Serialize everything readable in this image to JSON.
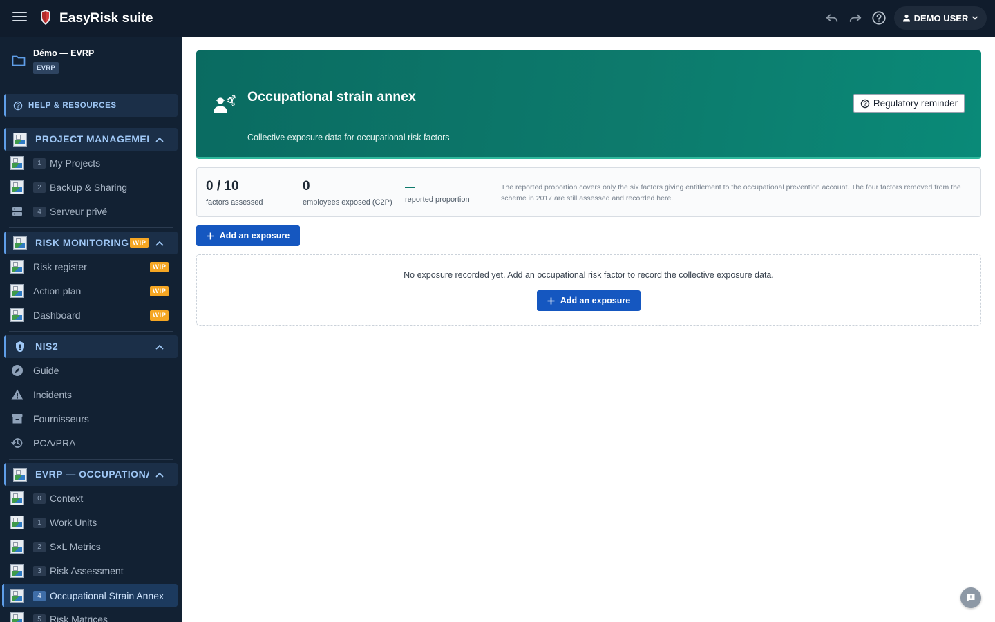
{
  "app": {
    "title": "EasyRisk suite",
    "user_label": "DEMO USER"
  },
  "project": {
    "name": "Démo — EVRP",
    "badge": "EVRP"
  },
  "sidebar": {
    "help_label": "HELP & RESOURCES",
    "project_management": {
      "label": "PROJECT MANAGEMEN",
      "items": [
        {
          "num": "1",
          "label": "My Projects"
        },
        {
          "num": "2",
          "label": "Backup & Sharing"
        },
        {
          "num": "4",
          "label": "Serveur privé"
        }
      ]
    },
    "risk_monitoring": {
      "label": "RISK MONITORING",
      "badge": "WIP",
      "items": [
        {
          "label": "Risk register",
          "badge": "WIP"
        },
        {
          "label": "Action plan",
          "badge": "WIP"
        },
        {
          "label": "Dashboard",
          "badge": "WIP"
        }
      ]
    },
    "nis2": {
      "label": "NIS2",
      "items": [
        {
          "label": "Guide",
          "icon": "compass-icon"
        },
        {
          "label": "Incidents",
          "icon": "warning-icon"
        },
        {
          "label": "Fournisseurs",
          "icon": "archive-icon"
        },
        {
          "label": "PCA/PRA",
          "icon": "history-icon"
        }
      ]
    },
    "evrp": {
      "label": "EVRP — OCCUPATIONAL",
      "items": [
        {
          "num": "0",
          "label": "Context"
        },
        {
          "num": "1",
          "label": "Work Units"
        },
        {
          "num": "2",
          "label": "S×L Metrics"
        },
        {
          "num": "3",
          "label": "Risk Assessment"
        },
        {
          "num": "4",
          "label": "Occupational Strain Annex"
        },
        {
          "num": "5",
          "label": "Risk Matrices"
        }
      ]
    }
  },
  "banner": {
    "title": "Occupational strain annex",
    "subtitle": "Collective exposure data for occupational risk factors",
    "reminder_label": "Regulatory reminder"
  },
  "stats": {
    "factors_value": "0 / 10",
    "factors_label": "factors assessed",
    "employees_value": "0",
    "employees_label": "employees exposed (C2P)",
    "proportion_label": "reported proportion",
    "note": "The reported proportion covers only the six factors giving entitlement to the occupational prevention account. The four factors removed from the scheme in 2017 are still assessed and recorded here."
  },
  "actions": {
    "add_exposure_label": "Add an exposure"
  },
  "empty_state": {
    "message": "No exposure recorded yet. Add an occupational risk factor to record the collective exposure data.",
    "button_label": "Add an exposure"
  },
  "colors": {
    "topbar": "#101c2c",
    "sidebar": "#122133",
    "accent": "#5f9ee8",
    "banner": "#0d7a6c",
    "primary_button": "#1557c0",
    "wip": "#f5a623"
  }
}
